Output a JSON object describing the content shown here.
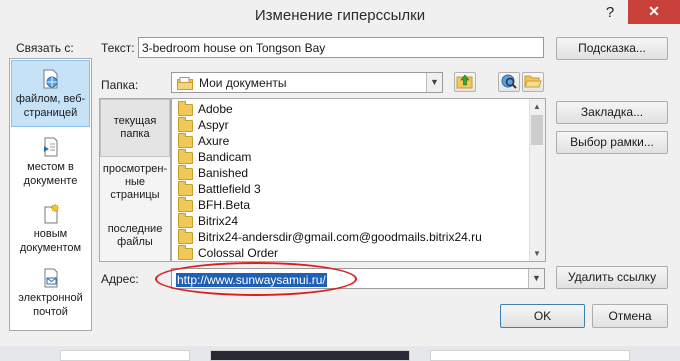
{
  "window": {
    "title": "Изменение гиперссылки",
    "help_label": "?",
    "close_label": "✕"
  },
  "link_to": {
    "label": "Связать с:",
    "items": [
      {
        "label_l1": "файлом, веб-",
        "label_l2": "страницей",
        "icon": "globe-file-icon"
      },
      {
        "label_l1": "местом в",
        "label_l2": "документе",
        "icon": "document-place-icon"
      },
      {
        "label_l1": "новым",
        "label_l2": "документом",
        "icon": "new-document-icon"
      },
      {
        "label_l1": "электронной",
        "label_l2": "почтой",
        "icon": "email-icon"
      }
    ]
  },
  "text_field": {
    "label": "Текст:",
    "value": "3-bedroom house on Tongson Bay"
  },
  "folder_field": {
    "label": "Папка:",
    "value": "Мои документы"
  },
  "nav": {
    "current": {
      "l1": "текущая",
      "l2": "папка"
    },
    "browsed": {
      "l1": "просмотрен-",
      "l2": "ные",
      "l3": "страницы"
    },
    "recent": {
      "l1": "последние",
      "l2": "файлы"
    }
  },
  "files": [
    "Adobe",
    "Aspyr",
    "Axure",
    "Bandicam",
    "Banished",
    "Battlefield 3",
    "BFH.Beta",
    "Bitrix24",
    "Bitrix24-andersdir@gmail.com@goodmails.bitrix24.ru",
    "Colossal Order"
  ],
  "address": {
    "label": "Адрес:",
    "value": "http://www.sunwaysamui.ru/"
  },
  "buttons": {
    "hint": "Подсказка...",
    "bookmark": "Закладка...",
    "target_frame": "Выбор рамки...",
    "remove_link": "Удалить ссылку",
    "ok": "OK",
    "cancel": "Отмена"
  },
  "colors": {
    "accent_selection": "#c6e2f7",
    "highlight_url": "#1e5fb8",
    "annotation_oval": "#d92020",
    "close_button": "#c7413a"
  }
}
